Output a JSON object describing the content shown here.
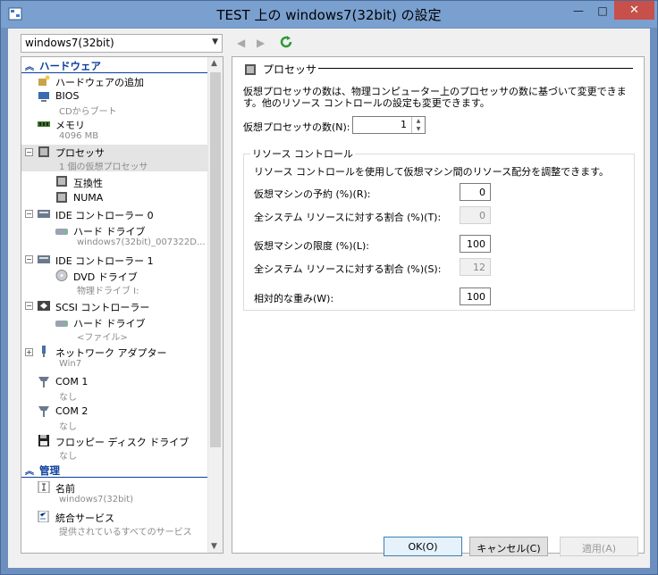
{
  "window": {
    "title": "TEST 上の windows7(32bit) の設定",
    "min": "—",
    "max": "□",
    "close": "✕"
  },
  "vm_select": {
    "value": "windows7(32bit)"
  },
  "tree": {
    "hardware_header": "ハードウェア",
    "management_header": "管理",
    "items": [
      {
        "title": "ハードウェアの追加",
        "sub": ""
      },
      {
        "title": "BIOS",
        "sub": "CDからブート"
      },
      {
        "title": "メモリ",
        "sub": "4096 MB"
      },
      {
        "title": "プロセッサ",
        "sub": "1 個の仮想プロセッサ"
      },
      {
        "title": "互換性",
        "sub": ""
      },
      {
        "title": "NUMA",
        "sub": ""
      },
      {
        "title": "IDE コントローラー 0",
        "sub": ""
      },
      {
        "title": "ハード ドライブ",
        "sub": "windows7(32bit)_007322D..."
      },
      {
        "title": "IDE コントローラー 1",
        "sub": ""
      },
      {
        "title": "DVD ドライブ",
        "sub": "物理ドライブ I:"
      },
      {
        "title": "SCSI コントローラー",
        "sub": ""
      },
      {
        "title": "ハード ドライブ",
        "sub": "<ファイル>"
      },
      {
        "title": "ネットワーク アダプター",
        "sub": "Win7"
      },
      {
        "title": "COM 1",
        "sub": "なし"
      },
      {
        "title": "COM 2",
        "sub": "なし"
      },
      {
        "title": "フロッピー ディスク ドライブ",
        "sub": "なし"
      },
      {
        "title": "名前",
        "sub": "windows7(32bit)"
      },
      {
        "title": "統合サービス",
        "sub": "提供されているすべてのサービス"
      }
    ]
  },
  "panel": {
    "header": "プロセッサ",
    "description": "仮想プロセッサの数は、物理コンピューター上のプロセッサの数に基づいて変更できます。他のリソース コントロールの設定も変更できます。",
    "vcpu_label": "仮想プロセッサの数(N):",
    "vcpu_value": "1",
    "group_title": "リソース コントロール",
    "group_desc": "リソース コントロールを使用して仮想マシン間のリソース配分を調整できます。",
    "reserve_label": "仮想マシンの予約 (%)(R):",
    "reserve_value": "0",
    "reserve_pct_label": "全システム リソースに対する割合 (%)(T):",
    "reserve_pct_value": "0",
    "limit_label": "仮想マシンの限度 (%)(L):",
    "limit_value": "100",
    "limit_pct_label": "全システム リソースに対する割合 (%)(S):",
    "limit_pct_value": "12",
    "weight_label": "相対的な重み(W):",
    "weight_value": "100"
  },
  "buttons": {
    "ok": "OK(O)",
    "cancel": "キャンセル(C)",
    "apply": "適用(A)"
  }
}
